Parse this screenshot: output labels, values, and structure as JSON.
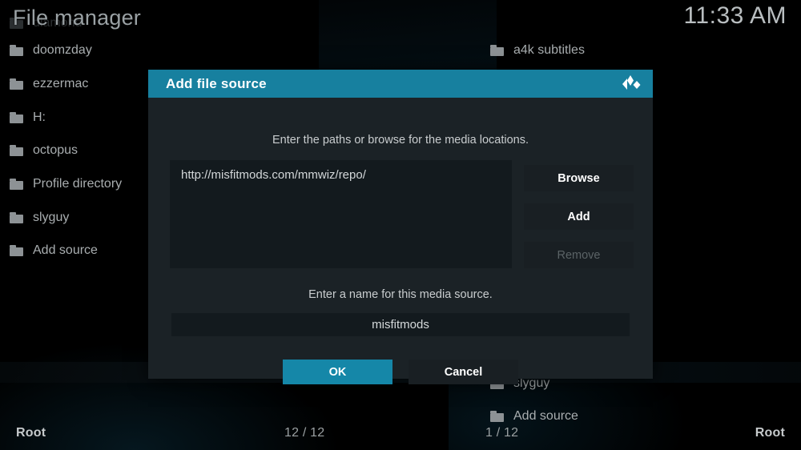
{
  "window": {
    "title": "File manager",
    "clock": "11:33 AM"
  },
  "colors": {
    "accent": "#17809f",
    "accent_button": "#1587a8",
    "dialog_bg": "#1b2226",
    "field_bg": "#131a1e",
    "button_bg": "#191f23",
    "text": "#c9cdcf",
    "text_muted": "#5b6366"
  },
  "left_pane": {
    "items": [
      {
        "label": "diamond",
        "icon": "folder-icon",
        "faded": true
      },
      {
        "label": "doomzday",
        "icon": "folder-icon",
        "faded": false
      },
      {
        "label": "ezzermac",
        "icon": "folder-icon",
        "faded": false
      },
      {
        "label": "H:",
        "icon": "folder-icon",
        "faded": false
      },
      {
        "label": "octopus",
        "icon": "folder-icon",
        "faded": false
      },
      {
        "label": "Profile directory",
        "icon": "folder-icon",
        "faded": false
      },
      {
        "label": "slyguy",
        "icon": "folder-icon",
        "faded": false
      },
      {
        "label": "Add source",
        "icon": "folder-icon",
        "faded": false
      }
    ],
    "status_path": "Root",
    "status_count": "12 / 12"
  },
  "right_pane": {
    "items": [
      {
        "label": "a4k subtitles",
        "icon": "folder-icon",
        "faded": false
      },
      {
        "label": "slyguy",
        "icon": "folder-icon",
        "faded": false
      },
      {
        "label": "Add source",
        "icon": "folder-icon",
        "faded": false
      }
    ],
    "status_path": "Root",
    "status_count": "1 / 12"
  },
  "dialog": {
    "title": "Add file source",
    "logo_icon": "kodi-logo-icon",
    "paths_hint": "Enter the paths or browse for the media locations.",
    "path_value": "http://misfitmods.com/mmwiz/repo/",
    "side_buttons": [
      {
        "label": "Browse",
        "enabled": true
      },
      {
        "label": "Add",
        "enabled": true
      },
      {
        "label": "Remove",
        "enabled": false
      }
    ],
    "name_hint": "Enter a name for this media source.",
    "name_value": "misfitmods",
    "ok_label": "OK",
    "cancel_label": "Cancel"
  }
}
